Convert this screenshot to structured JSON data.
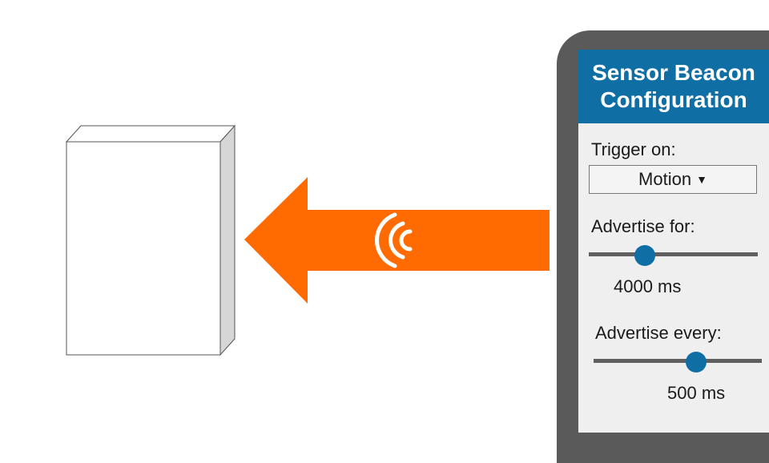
{
  "colors": {
    "accent": "#0f6ea3",
    "arrow": "#ff6b00",
    "phone_frame": "#5a5a5a",
    "screen_bg": "#efefef"
  },
  "icons": {
    "beacon": "box-icon",
    "signal": "wireless-signal-icon",
    "dropdown": "caret-down-icon"
  },
  "app": {
    "title_line1": "Sensor Beacon",
    "title_line2": "Configuration",
    "trigger_label": "Trigger on:",
    "trigger_value": "Motion",
    "advertise_for_label": "Advertise for:",
    "advertise_for_value": "4000 ms",
    "advertise_for_level": 0.33,
    "advertise_every_label": "Advertise every:",
    "advertise_every_value": "500 ms",
    "advertise_every_level": 0.61
  }
}
